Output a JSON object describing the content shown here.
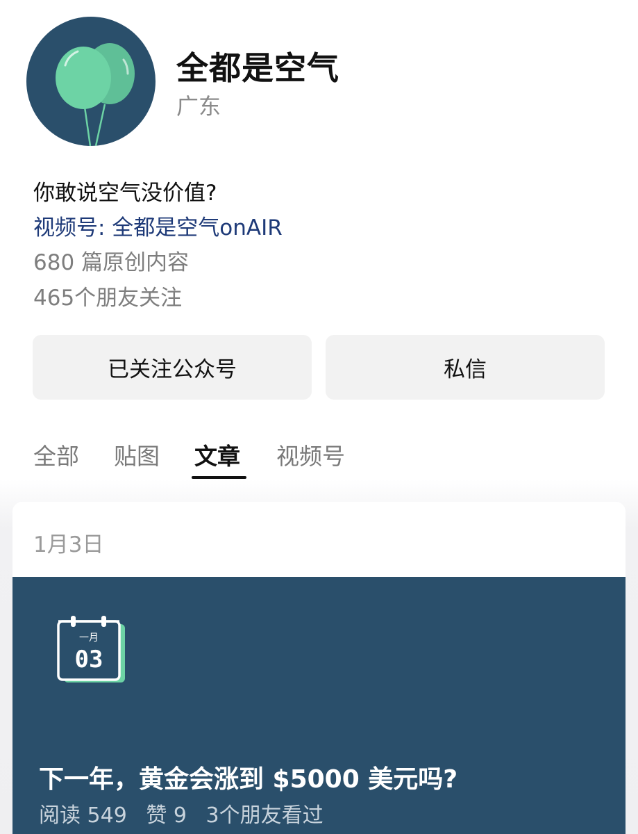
{
  "profile": {
    "name": "全都是空气",
    "region": "广东",
    "bio": "你敢说空气没价值?",
    "channel": "视频号: 全都是空气onAIR",
    "original_count": "680 篇原创内容",
    "followers": "465个朋友关注"
  },
  "actions": {
    "follow_label": "已关注公众号",
    "message_label": "私信"
  },
  "tabs": [
    {
      "label": "全部"
    },
    {
      "label": "贴图"
    },
    {
      "label": "文章",
      "active": true
    },
    {
      "label": "视频号"
    }
  ],
  "article": {
    "date": "1月3日",
    "cover_month": "一月",
    "cover_day": "03",
    "title": "下一年，黄金会涨到 $5000 美元吗?",
    "reads": "阅读 549",
    "likes": "赞 9",
    "friends_read": "3个朋友看过"
  },
  "colors": {
    "avatar_bg": "#2a4f6b",
    "balloon": "#6dd3a5",
    "link": "#1e3a78",
    "cover_bg": "#2a4f6b"
  }
}
